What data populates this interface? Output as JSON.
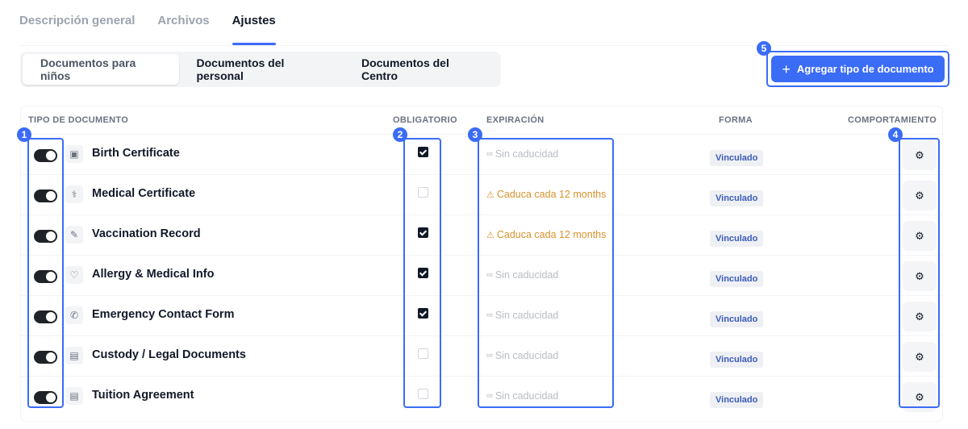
{
  "top_tabs": [
    {
      "label": "Descripción general",
      "active": false
    },
    {
      "label": "Archivos",
      "active": false
    },
    {
      "label": "Ajustes",
      "active": true
    }
  ],
  "sub_tabs": [
    {
      "label": "Documentos para niños",
      "active": true
    },
    {
      "label": "Documentos del personal",
      "active": false
    },
    {
      "label": "Documentos del Centro",
      "active": false
    }
  ],
  "add_button": {
    "label": "Agregar tipo de documento",
    "icon": "plus-icon"
  },
  "table": {
    "columns": {
      "type": "TIPO DE DOCUMENTO",
      "required": "OBLIGATORIO",
      "expiration": "EXPIRACIÓN",
      "form": "FORMA",
      "behavior": "COMPORTAMIENTO"
    },
    "rows": [
      {
        "enabled": true,
        "icon": "id-card-icon",
        "glyph": "▣",
        "name": "Birth Certificate",
        "required": true,
        "expiration": "Sin caducidad",
        "expires": false,
        "form": "Vinculado"
      },
      {
        "enabled": true,
        "icon": "medical-icon",
        "glyph": "⚕",
        "name": "Medical Certificate",
        "required": false,
        "expiration": "Caduca cada 12 months",
        "expires": true,
        "form": "Vinculado"
      },
      {
        "enabled": true,
        "icon": "syringe-icon",
        "glyph": "✎",
        "name": "Vaccination Record",
        "required": true,
        "expiration": "Caduca cada 12 months",
        "expires": true,
        "form": "Vinculado"
      },
      {
        "enabled": true,
        "icon": "heart-icon",
        "glyph": "♡",
        "name": "Allergy & Medical Info",
        "required": true,
        "expiration": "Sin caducidad",
        "expires": false,
        "form": "Vinculado"
      },
      {
        "enabled": true,
        "icon": "phone-icon",
        "glyph": "✆",
        "name": "Emergency Contact Form",
        "required": true,
        "expiration": "Sin caducidad",
        "expires": false,
        "form": "Vinculado"
      },
      {
        "enabled": true,
        "icon": "document-icon",
        "glyph": "▤",
        "name": "Custody / Legal Documents",
        "required": false,
        "expiration": "Sin caducidad",
        "expires": false,
        "form": "Vinculado"
      },
      {
        "enabled": true,
        "icon": "document-icon",
        "glyph": "▤",
        "name": "Tuition Agreement",
        "required": false,
        "expiration": "Sin caducidad",
        "expires": false,
        "form": "Vinculado"
      }
    ]
  },
  "annotations": [
    "1",
    "2",
    "3",
    "4",
    "5"
  ],
  "colors": {
    "accent": "#3b6cf6",
    "warning": "#d9922b",
    "muted": "#b8bcc3",
    "toggle_on": "#1f2328"
  }
}
